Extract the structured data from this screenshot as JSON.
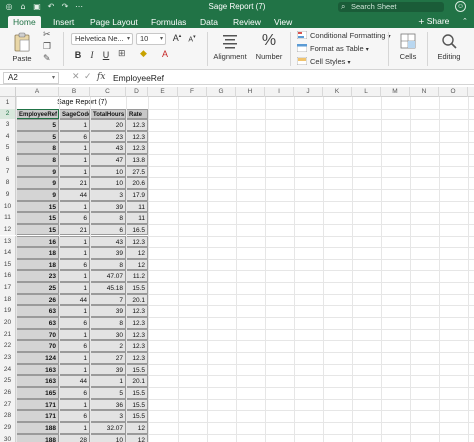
{
  "window": {
    "title": "Sage Report (7)",
    "search_placeholder": "Search Sheet",
    "share_label": "Share"
  },
  "ribbon_tabs": [
    "Home",
    "Insert",
    "Page Layout",
    "Formulas",
    "Data",
    "Review",
    "View"
  ],
  "active_tab": "Home",
  "ribbon": {
    "paste_label": "Paste",
    "font_name": "Helvetica Ne...",
    "font_size": "10",
    "alignment_label": "Alignment",
    "number_label": "Number",
    "conditional_formatting": "Conditional Formatting",
    "format_as_table": "Format as Table",
    "cell_styles": "Cell Styles",
    "cells_label": "Cells",
    "editing_label": "Editing",
    "bold": "B",
    "italic": "I",
    "underline": "U",
    "increase_font": "A",
    "decrease_font": "A",
    "percent": "%"
  },
  "formula_bar": {
    "name_box": "A2",
    "fx": "fx",
    "content": "EmployeeRef"
  },
  "columns": [
    "A",
    "B",
    "C",
    "D",
    "E",
    "F",
    "G",
    "H",
    "I",
    "J",
    "K",
    "L",
    "M",
    "N",
    "O"
  ],
  "sheet": {
    "report_title": "Sage Report (7)",
    "headers": [
      "EmployeeRef",
      "SageCode",
      "TotalHours",
      "Rate"
    ],
    "rows": [
      [
        "5",
        "1",
        "20",
        "12.3"
      ],
      [
        "5",
        "6",
        "23",
        "12.3"
      ],
      [
        "8",
        "1",
        "43",
        "12.3"
      ],
      [
        "8",
        "1",
        "47",
        "13.8"
      ],
      [
        "9",
        "1",
        "10",
        "27.5"
      ],
      [
        "9",
        "21",
        "10",
        "20.6"
      ],
      [
        "9",
        "44",
        "3",
        "17.9"
      ],
      [
        "15",
        "1",
        "39",
        "11"
      ],
      [
        "15",
        "6",
        "8",
        "11"
      ],
      [
        "15",
        "21",
        "6",
        "16.5"
      ],
      [
        "16",
        "1",
        "43",
        "12.3"
      ],
      [
        "18",
        "1",
        "39",
        "12"
      ],
      [
        "18",
        "6",
        "8",
        "12"
      ],
      [
        "23",
        "1",
        "47.07",
        "11.2"
      ],
      [
        "25",
        "1",
        "45.18",
        "15.5"
      ],
      [
        "26",
        "44",
        "7",
        "20.1"
      ],
      [
        "63",
        "1",
        "39",
        "12.3"
      ],
      [
        "63",
        "6",
        "8",
        "12.3"
      ],
      [
        "70",
        "1",
        "30",
        "12.3"
      ],
      [
        "70",
        "6",
        "2",
        "12.3"
      ],
      [
        "124",
        "1",
        "27",
        "12.3"
      ],
      [
        "163",
        "1",
        "39",
        "15.5"
      ],
      [
        "163",
        "44",
        "1",
        "20.1"
      ],
      [
        "165",
        "6",
        "5",
        "15.5"
      ],
      [
        "171",
        "1",
        "36",
        "15.5"
      ],
      [
        "171",
        "6",
        "3",
        "15.5"
      ],
      [
        "188",
        "1",
        "32.07",
        "12"
      ],
      [
        "188",
        "28",
        "10",
        "12"
      ]
    ]
  },
  "row_numbers": [
    "1",
    "2",
    "3",
    "4",
    "5",
    "6",
    "7",
    "8",
    "9",
    "10",
    "11",
    "12",
    "13",
    "14",
    "15",
    "16",
    "17",
    "18",
    "19",
    "20",
    "21",
    "22",
    "23",
    "24",
    "25",
    "26",
    "27",
    "28",
    "29",
    "30"
  ],
  "colors": {
    "title_bar": "#217346",
    "header_fill": "#c8c8c8",
    "data_fill": "#e3e3e3"
  }
}
